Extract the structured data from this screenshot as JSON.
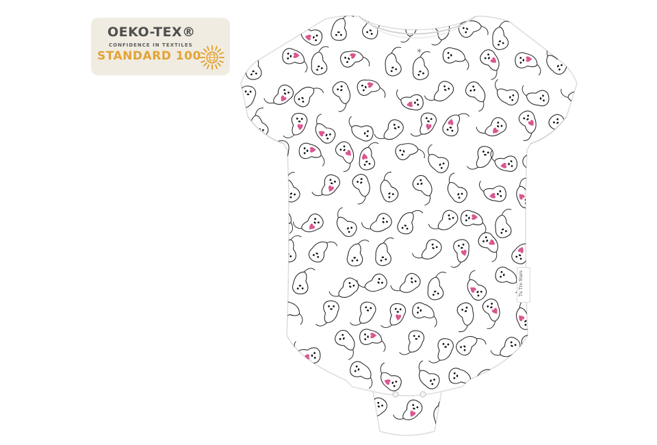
{
  "badge": {
    "brand": "OEKO-TEX®",
    "tagline": "CONFIDENCE IN TEXTILES",
    "standard": "STANDARD 100",
    "brand_color": "#4f4f4f",
    "accent_color": "#e3a336",
    "background_color": "#f0ece2",
    "icon": "sun-globe-icon"
  },
  "product": {
    "garment": "bodysuit",
    "pattern": "otter-print",
    "pattern_accent_color": "#d9578f",
    "base_color": "#ffffff",
    "tag_text": "Tu Tre Stars"
  }
}
